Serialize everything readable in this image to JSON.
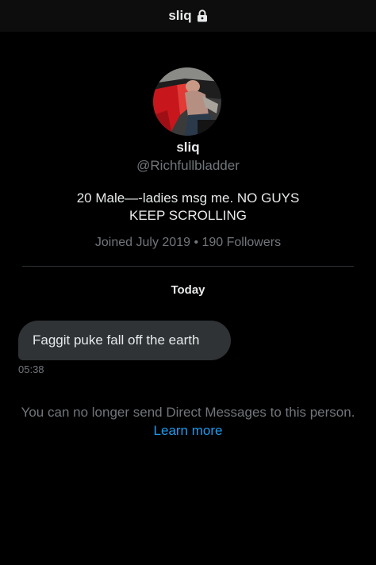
{
  "header": {
    "title": "sliq",
    "lock_icon": "lock-icon"
  },
  "profile": {
    "avatar": "avatar-photo",
    "name": "sliq",
    "handle": "@Richfullbladder",
    "bio_lines": [
      "20 Male—-ladies msg me. NO GUYS",
      "KEEP SCROLLING"
    ],
    "meta": "Joined July 2019 • 190 Followers"
  },
  "conversation": {
    "date_label": "Today",
    "messages": [
      {
        "text": "Faggit puke fall off the earth",
        "time": "05:38"
      }
    ]
  },
  "notice": {
    "text": "You can no longer send Direct Messages to this person.",
    "link": "Learn more"
  },
  "colors": {
    "background": "#000000",
    "text": "#e7e9ea",
    "secondary_text": "#71767b",
    "bubble": "#2f3336",
    "link": "#1d9bf0"
  }
}
